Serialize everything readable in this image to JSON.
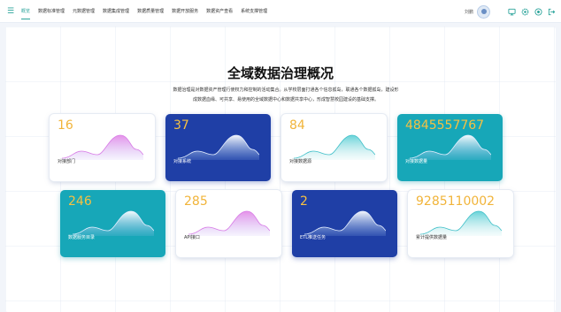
{
  "nav": {
    "items": [
      "概览",
      "数据标准管理",
      "元数据管理",
      "数据集成管理",
      "数据质量管理",
      "数据开放服务",
      "数据资产查看",
      "系统支撑管理"
    ],
    "active_index": 0
  },
  "user": {
    "name": "刘鹏"
  },
  "page": {
    "title": "全域数据治理概况",
    "description_line1": "数据治理是对数据资产管理行使权力和控制的活动集合。从学校层面打通各个信息孤岛，联通各个数据孤岛，建设形",
    "description_line2": "成数据血缘、可共享、易使用的全域数据中心和数据共享中心，形成智慧校园建设的基础支撑。"
  },
  "cards": [
    {
      "value": "16",
      "label": "对接部门",
      "style": "light",
      "wave": "pink"
    },
    {
      "value": "37",
      "label": "对接系统",
      "style": "navy",
      "wave": "light"
    },
    {
      "value": "84",
      "label": "对接数据源",
      "style": "light",
      "wave": "teal"
    },
    {
      "value": "4845557767",
      "label": "对接数据量",
      "style": "teal",
      "wave": "light"
    },
    {
      "value": "246",
      "label": "数据服务目录",
      "style": "teal",
      "wave": "light"
    },
    {
      "value": "285",
      "label": "API接口",
      "style": "light",
      "wave": "pink"
    },
    {
      "value": "2",
      "label": "ETL推送任务",
      "style": "navy",
      "wave": "light"
    },
    {
      "value": "9285110002",
      "label": "累计提供数据量",
      "style": "light",
      "wave": "teal"
    }
  ],
  "icons": {
    "menu": "menu-icon",
    "monitor": "monitor-icon",
    "settings": "gear-icon",
    "help": "help-icon",
    "logout": "logout-icon"
  },
  "colors": {
    "accent": "#2aa39a",
    "navy_card": "#1f3fa6",
    "teal_card": "#17a7b8",
    "number": "#f1b43a"
  }
}
